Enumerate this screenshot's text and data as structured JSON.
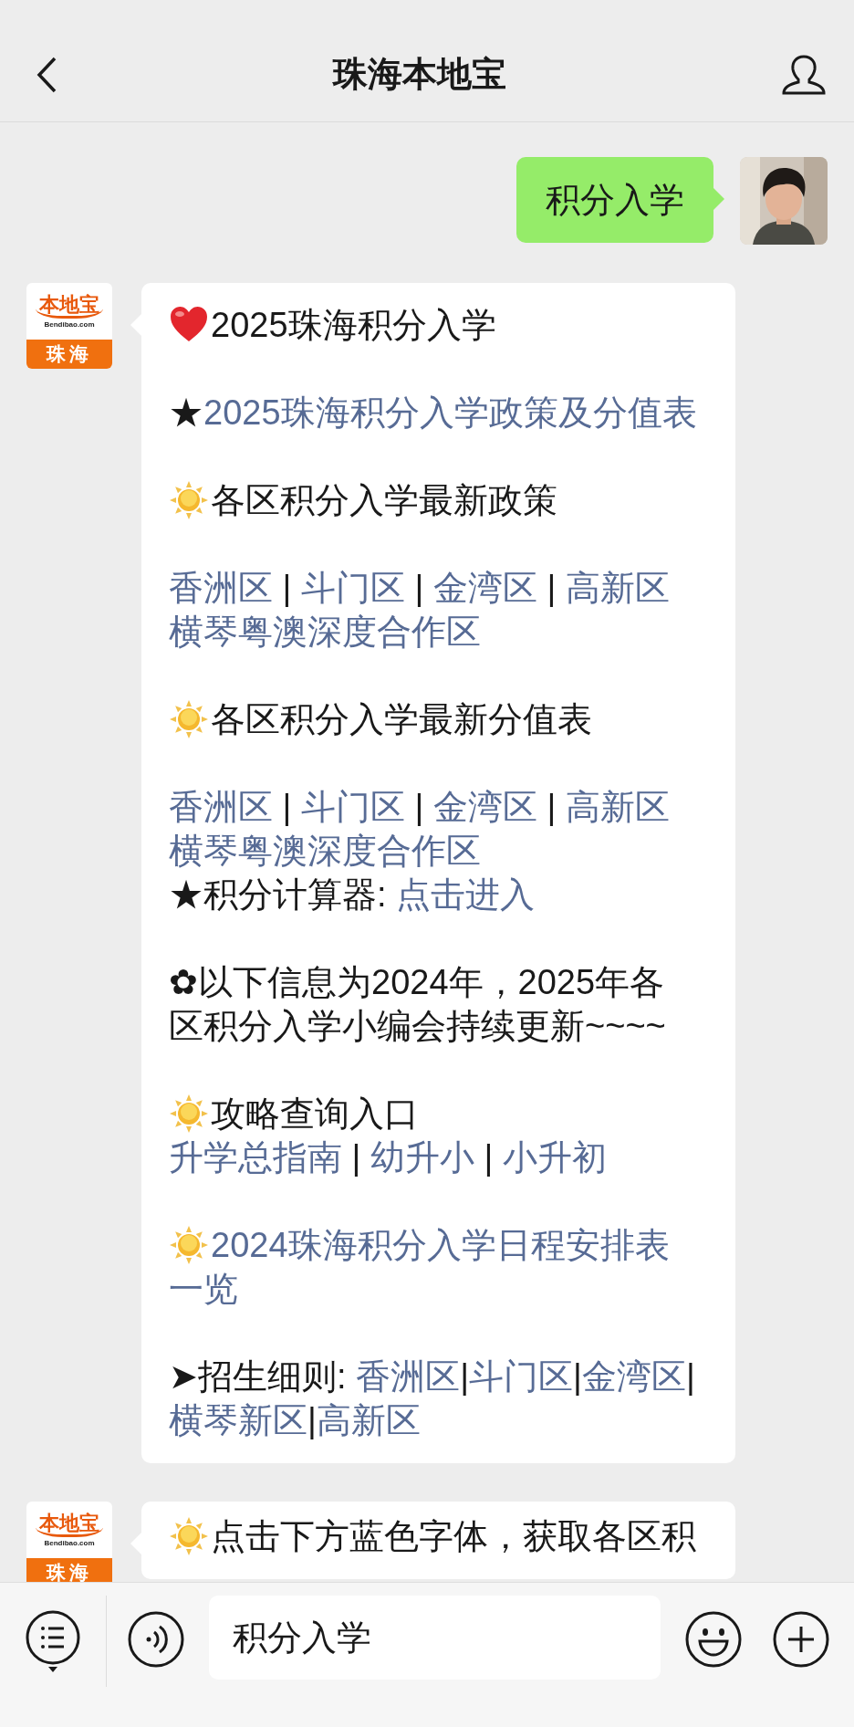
{
  "header": {
    "title": "珠海本地宝"
  },
  "messages": [
    {
      "kind": "sent",
      "text": "积分入学"
    },
    {
      "kind": "received",
      "logo": {
        "brand": "本地宝",
        "domain": "Bendibao.com",
        "city": "珠海"
      },
      "sections": [
        [
          {
            "kind": "heart",
            "segments": [
              {
                "text": "2025珠海积分入学",
                "kind": "text"
              }
            ]
          }
        ],
        [
          {
            "kind": "plain",
            "segments": [
              {
                "text": "★",
                "kind": "text"
              },
              {
                "text": "2025珠海积分入学政策及分值表",
                "kind": "link"
              }
            ]
          }
        ],
        [
          {
            "kind": "sun",
            "segments": [
              {
                "text": "各区积分入学最新政策",
                "kind": "text"
              }
            ]
          }
        ],
        [
          {
            "kind": "plain",
            "segments": [
              {
                "text": "香洲区",
                "kind": "link"
              },
              {
                "text": " | ",
                "kind": "text"
              },
              {
                "text": "斗门区",
                "kind": "link"
              },
              {
                "text": " | ",
                "kind": "text"
              },
              {
                "text": "金湾区",
                "kind": "link"
              },
              {
                "text": " | ",
                "kind": "text"
              },
              {
                "text": "高新区",
                "kind": "link"
              }
            ]
          },
          {
            "kind": "plain",
            "segments": [
              {
                "text": "横琴粤澳深度合作区",
                "kind": "link"
              }
            ]
          }
        ],
        [
          {
            "kind": "sun",
            "segments": [
              {
                "text": "各区积分入学最新分值表",
                "kind": "text"
              }
            ]
          }
        ],
        [
          {
            "kind": "plain",
            "segments": [
              {
                "text": "香洲区",
                "kind": "link"
              },
              {
                "text": " | ",
                "kind": "text"
              },
              {
                "text": "斗门区",
                "kind": "link"
              },
              {
                "text": " | ",
                "kind": "text"
              },
              {
                "text": "金湾区",
                "kind": "link"
              },
              {
                "text": " | ",
                "kind": "text"
              },
              {
                "text": "高新区",
                "kind": "link"
              }
            ]
          },
          {
            "kind": "plain",
            "segments": [
              {
                "text": "横琴粤澳深度合作区",
                "kind": "link"
              }
            ]
          },
          {
            "kind": "plain",
            "segments": [
              {
                "text": "★积分计算器: ",
                "kind": "text"
              },
              {
                "text": "点击进入",
                "kind": "link"
              }
            ]
          }
        ],
        [
          {
            "kind": "plain",
            "segments": [
              {
                "text": "✿以下信息为2024年，2025年各",
                "kind": "text"
              }
            ]
          },
          {
            "kind": "plain",
            "segments": [
              {
                "text": "区积分入学小编会持续更新~~~~",
                "kind": "text"
              }
            ]
          }
        ],
        [
          {
            "kind": "sun",
            "segments": [
              {
                "text": "攻略查询入口",
                "kind": "text"
              }
            ]
          },
          {
            "kind": "plain",
            "segments": [
              {
                "text": "升学总指南",
                "kind": "link"
              },
              {
                "text": " | ",
                "kind": "text"
              },
              {
                "text": "幼升小",
                "kind": "link"
              },
              {
                "text": " | ",
                "kind": "text"
              },
              {
                "text": "小升初",
                "kind": "link"
              }
            ]
          }
        ],
        [
          {
            "kind": "sun",
            "segments": [
              {
                "text": "2024珠海积分入学日程安排表",
                "kind": "link"
              }
            ]
          },
          {
            "kind": "plain",
            "segments": [
              {
                "text": "一览",
                "kind": "link"
              }
            ]
          }
        ],
        [
          {
            "kind": "plain",
            "segments": [
              {
                "text": "➤招生细则: ",
                "kind": "text"
              },
              {
                "text": "香洲区",
                "kind": "link"
              },
              {
                "text": "|",
                "kind": "text"
              },
              {
                "text": "斗门区",
                "kind": "link"
              },
              {
                "text": "|",
                "kind": "text"
              },
              {
                "text": "金湾区",
                "kind": "link"
              },
              {
                "text": "|",
                "kind": "text"
              }
            ]
          },
          {
            "kind": "plain",
            "segments": [
              {
                "text": "横琴新区",
                "kind": "link"
              },
              {
                "text": "|",
                "kind": "text"
              },
              {
                "text": "高新区",
                "kind": "link"
              }
            ]
          }
        ]
      ]
    },
    {
      "kind": "received",
      "logo": {
        "brand": "本地宝",
        "domain": "Bendibao.com",
        "city": "珠海"
      },
      "sections": [
        [
          {
            "kind": "sun",
            "segments": [
              {
                "text": "点击下方蓝色字体，获取各区积",
                "kind": "text"
              }
            ]
          }
        ]
      ]
    }
  ],
  "input_bar": {
    "value": "积分入学"
  }
}
